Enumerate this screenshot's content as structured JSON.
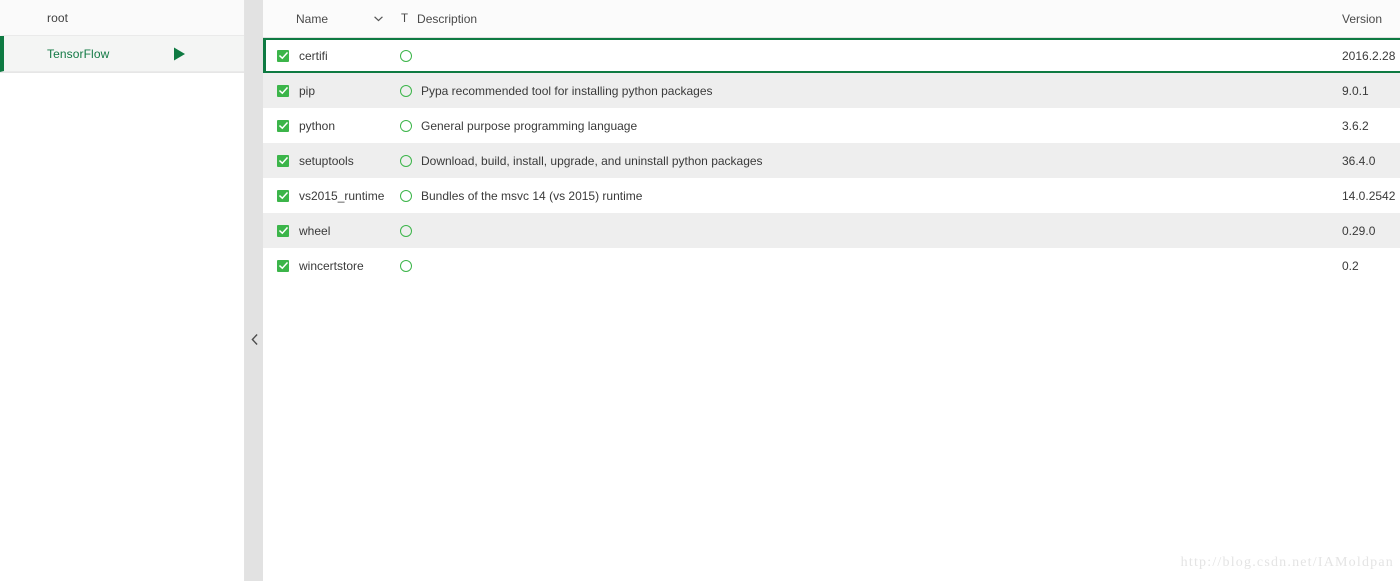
{
  "colors": {
    "accent_green": "#0e7a42",
    "check_green": "#3cb54a",
    "selected_row_border": "#0e7a42",
    "stripe_gray": "#eeeeee",
    "splitter_gray": "#e2e2e2",
    "watermark_gray": "#e4e4e4"
  },
  "sidebar": {
    "items": [
      {
        "label": "root",
        "selected": false,
        "has_play": false
      },
      {
        "label": "TensorFlow",
        "selected": true,
        "has_play": true
      }
    ],
    "collapse_icon": "chevron-left-icon"
  },
  "table": {
    "columns": {
      "name": "Name",
      "sort_icon": "chevron-down-icon",
      "type": "T",
      "description": "Description",
      "version": "Version"
    },
    "rows": [
      {
        "checked": true,
        "name": "certifi",
        "status_icon": "circle-outline-icon",
        "description": "",
        "version": "2016.2.28",
        "selected": true
      },
      {
        "checked": true,
        "name": "pip",
        "status_icon": "circle-outline-icon",
        "description": "Pypa recommended tool for installing python packages",
        "version": "9.0.1",
        "selected": false
      },
      {
        "checked": true,
        "name": "python",
        "status_icon": "circle-outline-icon",
        "description": "General purpose programming language",
        "version": "3.6.2",
        "selected": false
      },
      {
        "checked": true,
        "name": "setuptools",
        "status_icon": "circle-outline-icon",
        "description": "Download, build, install, upgrade, and uninstall python packages",
        "version": "36.4.0",
        "selected": false
      },
      {
        "checked": true,
        "name": "vs2015_runtime",
        "status_icon": "circle-outline-icon",
        "description": "Bundles of the msvc 14 (vs 2015) runtime",
        "version": "14.0.2542",
        "selected": false
      },
      {
        "checked": true,
        "name": "wheel",
        "status_icon": "circle-outline-icon",
        "description": "",
        "version": "0.29.0",
        "selected": false
      },
      {
        "checked": true,
        "name": "wincertstore",
        "status_icon": "circle-outline-icon",
        "description": "",
        "version": "0.2",
        "selected": false
      }
    ]
  },
  "watermark": "http://blog.csdn.net/IAMoldpan"
}
